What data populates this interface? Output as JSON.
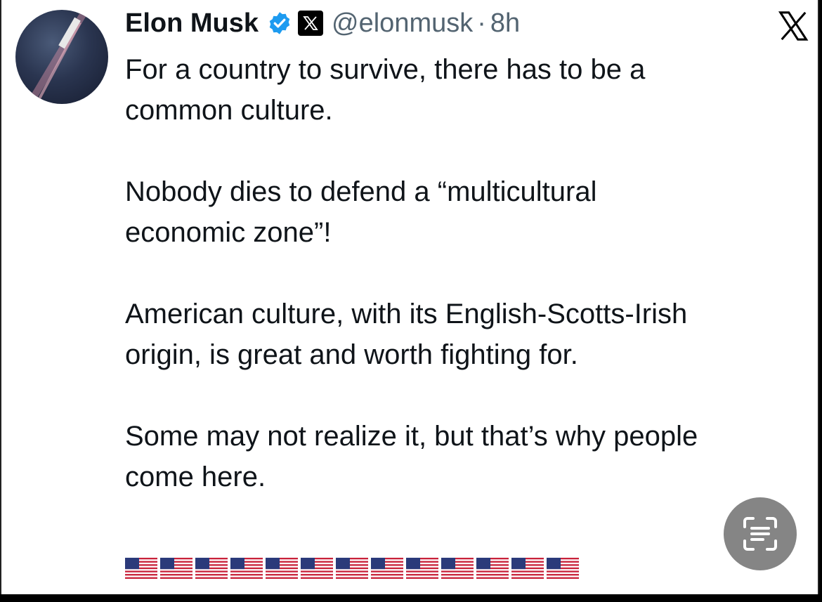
{
  "author": {
    "name": "Elon Musk",
    "handle": "@elonmusk",
    "separator": "·",
    "time": "8h",
    "verified_color": "#1d9bf0",
    "avatar_icon": "rocket-avatar"
  },
  "tweet": {
    "text": "For a country to survive, there has to be a\ncommon culture.\n\nNobody dies to defend a “multicultural\neconomic zone”!\n\nAmerican culture, with its English-Scotts-Irish\norigin, is great and worth fighting for.\n\nSome may not realize it, but that’s why people\ncome here.",
    "flags_count": 13,
    "flag_icon": "us-flag-emoji"
  },
  "ui": {
    "brand_icon": "x-logo-icon",
    "scan_icon": "live-text-scan-icon"
  }
}
